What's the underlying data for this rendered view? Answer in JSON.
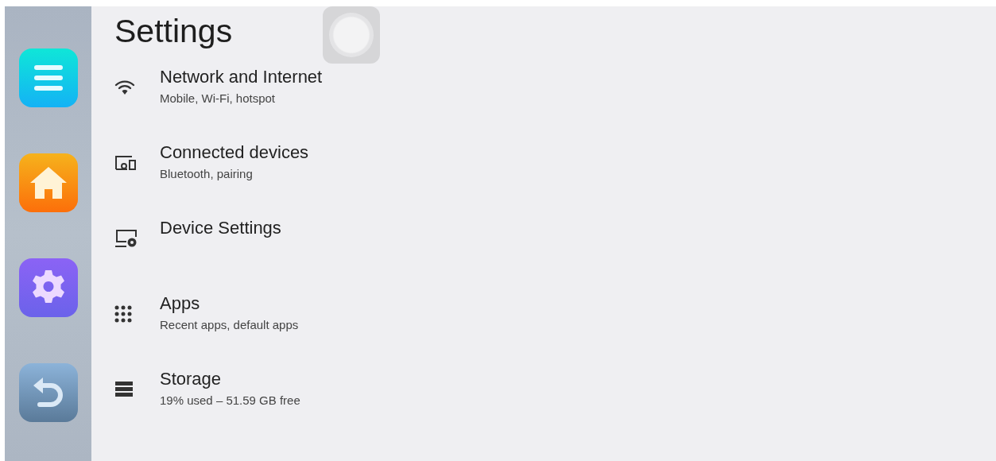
{
  "sidebar": {
    "buttons": [
      {
        "kind": "menu"
      },
      {
        "kind": "home"
      },
      {
        "kind": "settings"
      },
      {
        "kind": "back"
      }
    ]
  },
  "title": "Settings",
  "items": [
    {
      "kind": "wifi",
      "title": "Network and Internet",
      "subtitle": "Mobile, Wi-Fi, hotspot"
    },
    {
      "kind": "devices",
      "title": "Connected devices",
      "subtitle": "Bluetooth, pairing"
    },
    {
      "kind": "device-settings",
      "title": "Device Settings"
    },
    {
      "kind": "apps",
      "title": "Apps",
      "subtitle": "Recent apps, default apps"
    },
    {
      "kind": "storage",
      "title": "Storage",
      "subtitle": "19% used – 51.59 GB free"
    }
  ]
}
